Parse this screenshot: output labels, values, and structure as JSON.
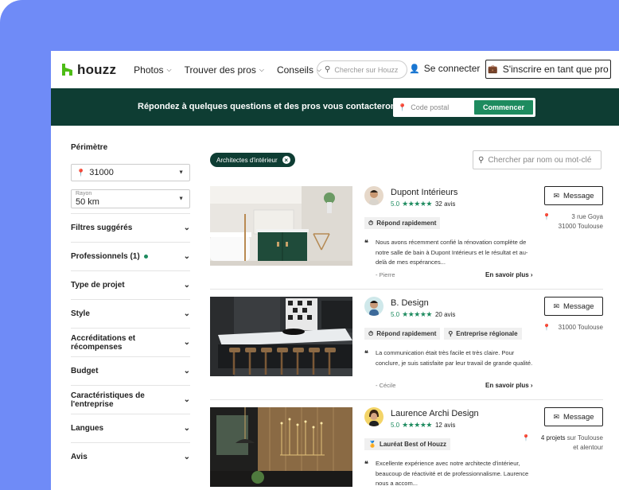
{
  "header": {
    "logo": "houzz",
    "nav": [
      "Photos",
      "Trouver des pros",
      "Conseils"
    ],
    "search_placeholder": "Chercher sur Houzz",
    "signin": "Se connecter",
    "pro_button": "S'inscrire en tant que pro"
  },
  "banner": {
    "text": "Répondez à quelques questions et des pros vous contacteront.",
    "postal_placeholder": "Code postal",
    "submit": "Commencer"
  },
  "sidebar": {
    "perimeter_title": "Périmètre",
    "location_value": "31000",
    "radius_label": "Rayon",
    "radius_value": "50 km",
    "filters": [
      "Filtres suggérés",
      "Professionnels (1)",
      "Type de projet",
      "Style",
      "Accréditations et récompenses",
      "Budget",
      "Caractéristiques de l'entreprise",
      "Langues",
      "Avis"
    ]
  },
  "main": {
    "active_filter": "Architectes d'intérieur",
    "search_placeholder": "Chercher par nom ou mot-clé",
    "message_label": "Message",
    "more_label": "En savoir plus",
    "pros": [
      {
        "name": "Dupont Intérieurs",
        "rating": "5.0",
        "stars": "★★★★★",
        "reviews": "32 avis",
        "badges": [
          "Répond rapidement"
        ],
        "review": "Nous avons récemment confié la rénovation complète de notre salle de bain à Dupont Intérieurs et le résultat et au-delà de mes espérances...",
        "author": "- Pierre",
        "address_line1": "3 rue Goya",
        "address_line2": "31000 Toulouse"
      },
      {
        "name": "B. Design",
        "rating": "5.0",
        "stars": "★★★★★",
        "reviews": "20 avis",
        "badges": [
          "Répond rapidement",
          "Entreprise régionale"
        ],
        "review": "La communication était très facile et très claire. Pour conclure, je suis satisfaite par leur travail de grande qualité.",
        "author": "- Cécile",
        "address_line1": "31000 Toulouse"
      },
      {
        "name": "Laurence Archi Design",
        "rating": "5.0",
        "stars": "★★★★★",
        "reviews": "12 avis",
        "badges": [
          "Lauréat Best of Houzz"
        ],
        "review": "Excellente expérience avec notre architecte d'intérieur, beaucoup de réactivité et de professionnalisme. Laurence nous a accom...",
        "projects": "4 projets",
        "projects_suffix": "sur Toulouse",
        "address_line2": "et alentour"
      }
    ]
  },
  "colors": {
    "brand_green": "#1e8b5f",
    "banner_bg": "#0e3d33",
    "outer_bg": "#6f8bf7"
  }
}
